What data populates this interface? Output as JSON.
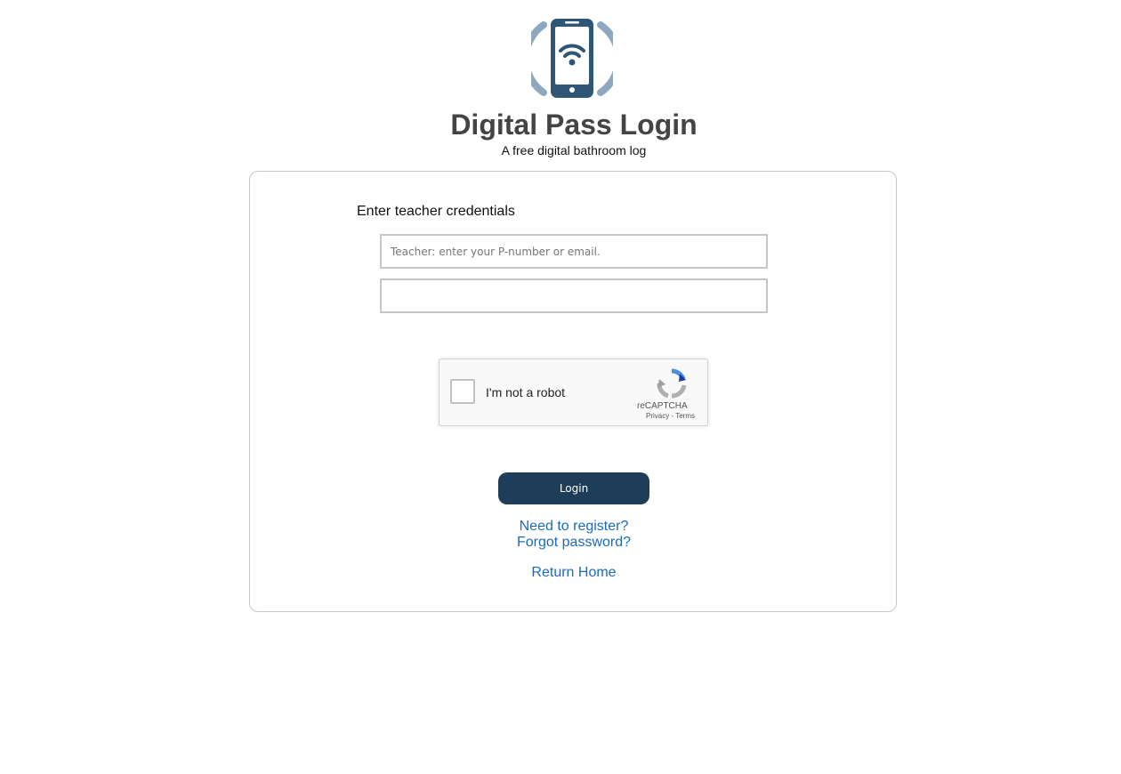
{
  "header": {
    "title": "Digital Pass Login",
    "subtitle": "A free digital bathroom log"
  },
  "form": {
    "section_label": "Enter teacher credentials",
    "username_placeholder": "Teacher: enter your P-number or email.",
    "username_value": "",
    "password_value": "",
    "login_label": "Login"
  },
  "captcha": {
    "label": "I'm not a robot",
    "brand": "reCAPTCHA",
    "privacy": "Privacy",
    "separator": " - ",
    "terms": "Terms",
    "icon": "recaptcha-icon"
  },
  "links": {
    "register": "Need to register?",
    "forgot": "Forgot password?",
    "home": "Return Home"
  },
  "colors": {
    "brand_dark": "#2f5674",
    "brand_light": "#8ea9bf",
    "button": "#1e3d58",
    "link": "#1a6bbf"
  },
  "logo": {
    "icon": "phone-wifi-icon"
  }
}
